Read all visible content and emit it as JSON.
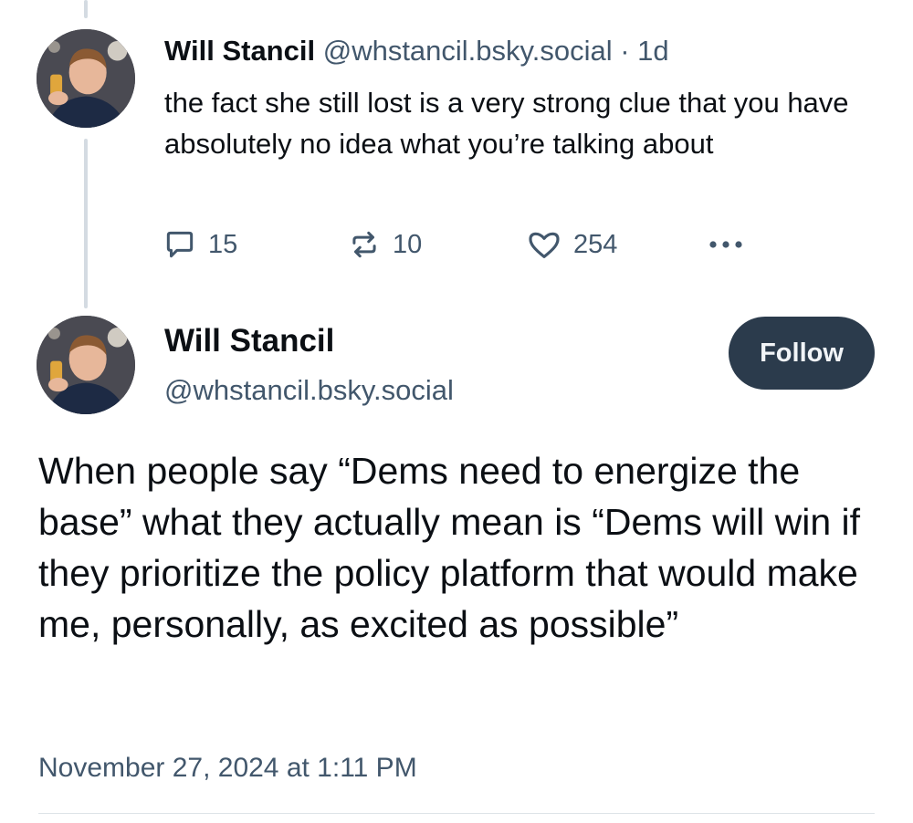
{
  "reply": {
    "author_name": "Will Stancil",
    "author_handle": "@whstancil.bsky.social",
    "separator": " · ",
    "time_ago": "1d",
    "text": "the fact she still lost is a very strong clue that you have absolutely no idea what you’re talking about",
    "reply_count": "15",
    "repost_count": "10",
    "like_count": "254"
  },
  "post": {
    "author_name": "Will Stancil",
    "author_handle": "@whstancil.bsky.social",
    "follow_label": "Follow",
    "text": "When people say “Dems need to energize the base” what they actually mean is “Dems will win if they prioritize the policy platform that would make me, personally, as excited as possible”",
    "timestamp": "November 27, 2024 at 1:11 PM"
  },
  "icons": {
    "reply": "speech-bubble-icon",
    "repost": "repost-arrows-icon",
    "like": "heart-icon",
    "more": "ellipsis-icon"
  },
  "colors": {
    "text_primary": "#0b0f14",
    "text_secondary": "#42576c",
    "follow_button_bg": "#2b3b4c",
    "thread_line": "#d4dbe2"
  }
}
